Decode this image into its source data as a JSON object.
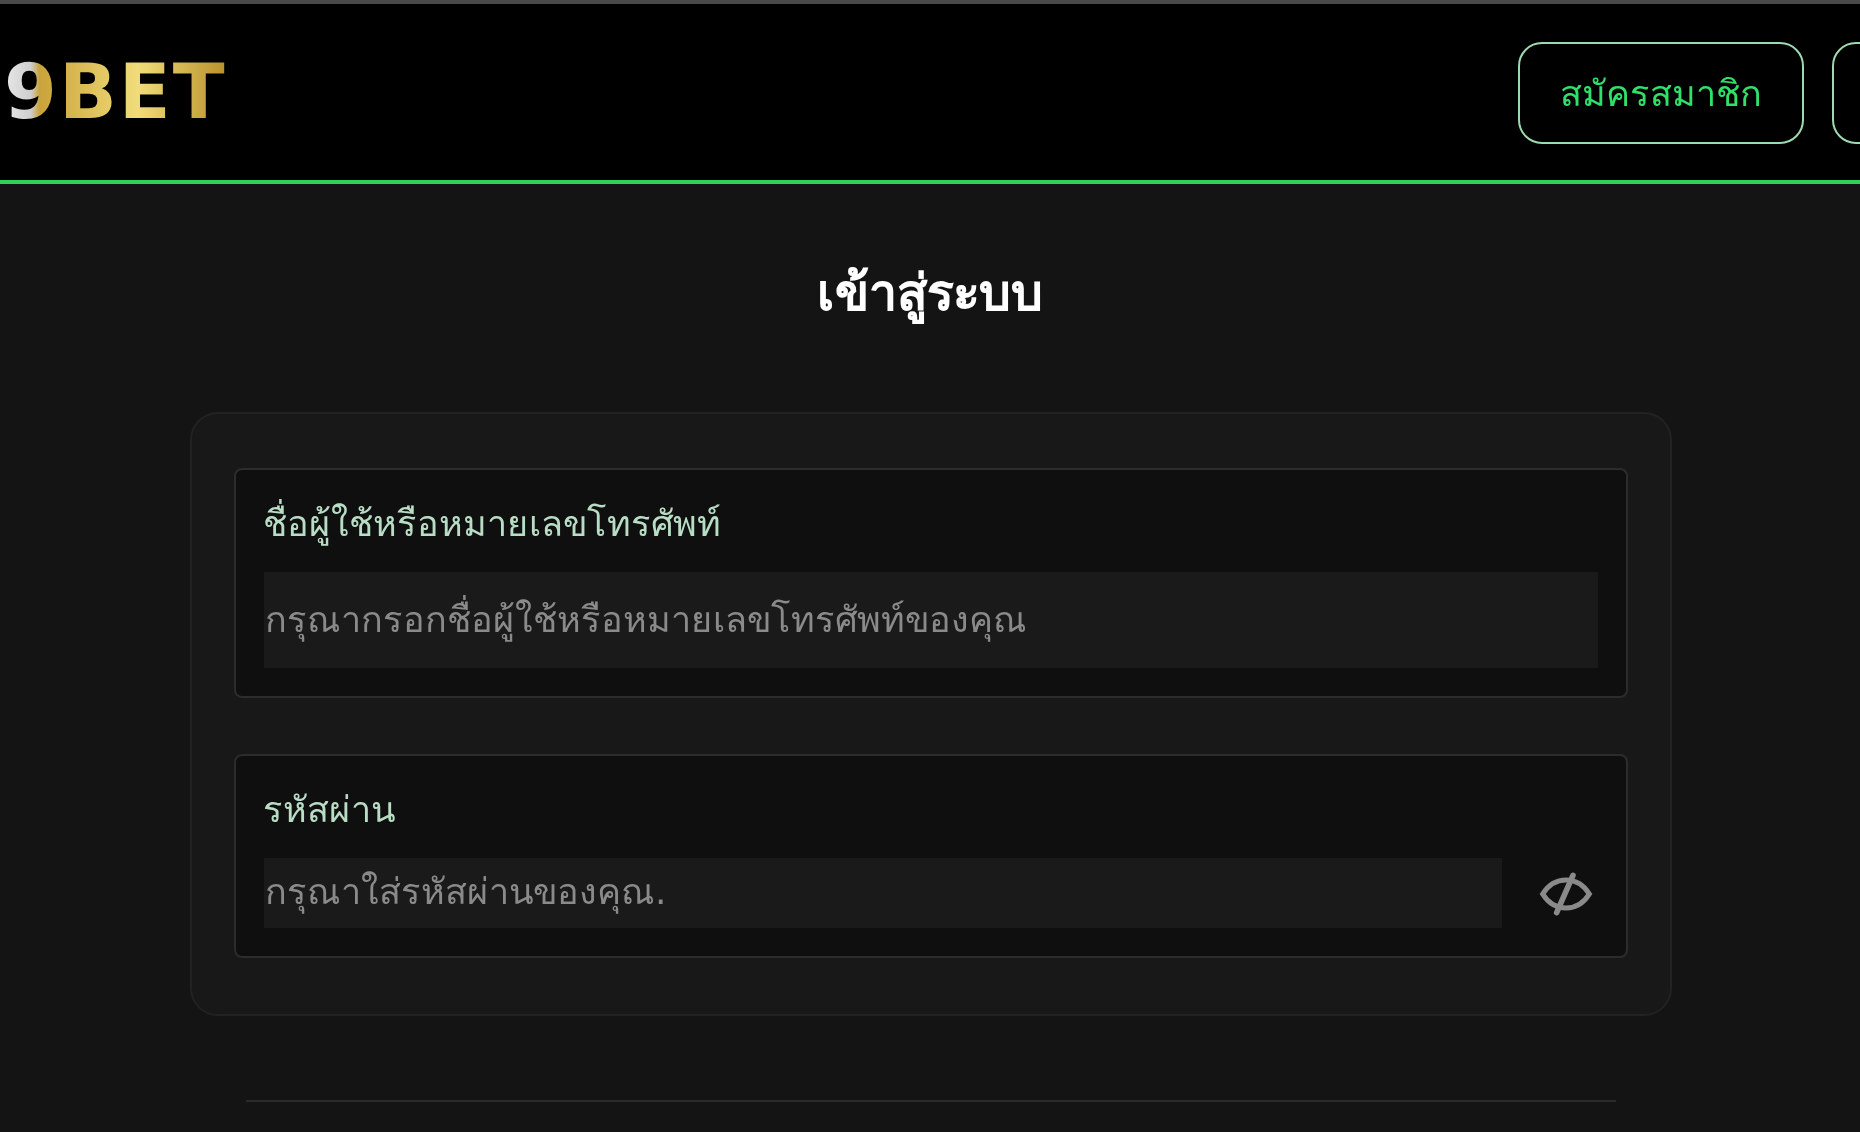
{
  "header": {
    "logo": "9BET",
    "register_button": "สมัครสมาชิก"
  },
  "title": "เข้าสู่ระบบ",
  "fields": [
    {
      "kind": "text",
      "label": "ชื่อผู้ใช้หรือหมายเลขโทรศัพท์",
      "placeholder": "กรุณากรอกชื่อผู้ใช้หรือหมายเลขโทรศัพท์ของคุณ"
    },
    {
      "kind": "password",
      "label": "รหัสผ่าน",
      "placeholder": "กรุณาใส่รหัสผ่านของคุณ."
    }
  ]
}
